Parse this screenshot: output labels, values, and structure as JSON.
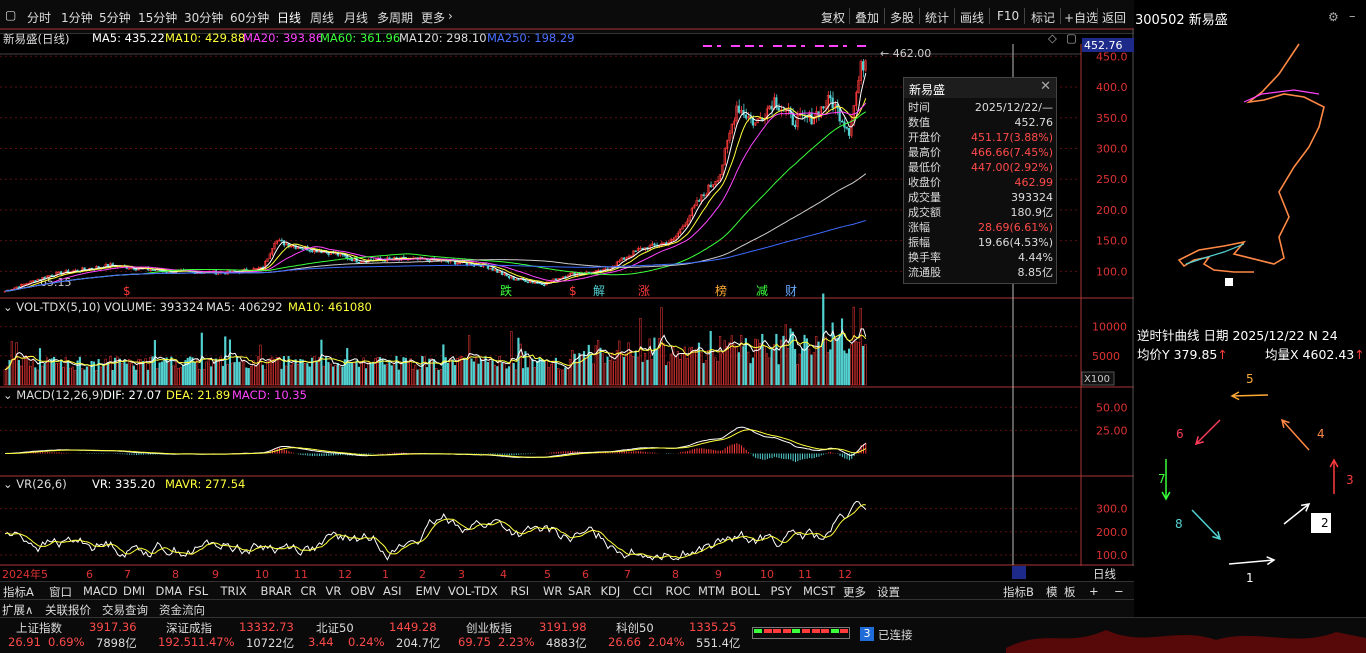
{
  "toolbar": {
    "periods": [
      "分时",
      "1分钟",
      "5分钟",
      "15分钟",
      "30分钟",
      "60分钟",
      "日线",
      "周线",
      "月线",
      "多周期",
      "更多"
    ],
    "active_period": "日线",
    "actions": [
      "复权",
      "叠加",
      "多股",
      "统计",
      "画线",
      "F10",
      "标记",
      "+自选",
      "返回"
    ]
  },
  "right_header": {
    "code_name": "300502 新易盛"
  },
  "price_header": {
    "stock": "新易盛(日线)",
    "ma5": "MA5: 435.22",
    "ma10": "MA10: 429.88",
    "ma20": "MA20: 393.86",
    "ma60": "MA60: 361.96",
    "ma120": "MA120: 298.10",
    "ma250": "MA250: 198.29"
  },
  "price_axis": {
    "ticks": [
      "450.0",
      "400.0",
      "350.0",
      "300.0",
      "250.0",
      "200.0",
      "150.0",
      "100.0"
    ],
    "current": "452.76",
    "high_label": "462.00",
    "low_label": "65.15"
  },
  "event_markers": [
    "$",
    "跌",
    "$",
    "解",
    "涨",
    "榜",
    "减",
    "财"
  ],
  "info_popup": {
    "title": "新易盛",
    "rows": [
      {
        "label": "时间",
        "value": "2025/12/22/—",
        "color": "#ddd"
      },
      {
        "label": "数值",
        "value": "452.76",
        "color": "#ddd"
      },
      {
        "label": "开盘价",
        "value": "451.17(3.88%)",
        "color": "#ff4a4a"
      },
      {
        "label": "最高价",
        "value": "466.66(7.45%)",
        "color": "#ff4a4a"
      },
      {
        "label": "最低价",
        "value": "447.00(2.92%)",
        "color": "#ff4a4a"
      },
      {
        "label": "收盘价",
        "value": "462.99",
        "color": "#ff4a4a"
      },
      {
        "label": "成交量",
        "value": "393324",
        "color": "#ddd"
      },
      {
        "label": "成交额",
        "value": "180.9亿",
        "color": "#ddd"
      },
      {
        "label": "涨幅",
        "value": "28.69(6.61%)",
        "color": "#ff4a4a"
      },
      {
        "label": "振幅",
        "value": "19.66(4.53%)",
        "color": "#ddd"
      },
      {
        "label": "换手率",
        "value": "4.44%",
        "color": "#ddd"
      },
      {
        "label": "流通股",
        "value": "8.85亿",
        "color": "#ddd"
      }
    ]
  },
  "vol_header": {
    "name": "VOL-TDX(5,10)",
    "volume": "VOLUME: 393324",
    "ma5": "MA5: 406292",
    "ma10": "MA10: 461080"
  },
  "vol_axis": {
    "ticks": [
      "10000",
      "5000"
    ],
    "unit": "X100"
  },
  "macd_header": {
    "name": "MACD(12,26,9)",
    "dif": "DIF: 27.07",
    "dea": "DEA: 21.89",
    "macd": "MACD: 10.35"
  },
  "macd_axis": {
    "ticks": [
      "50.00",
      "25.00"
    ]
  },
  "vr_header": {
    "name": "VR(26,6)",
    "vr": "VR: 335.20",
    "mavr": "MAVR: 277.54"
  },
  "vr_axis": {
    "ticks": [
      "300.0",
      "200.0",
      "100.0"
    ]
  },
  "date_axis": {
    "labels": [
      "2024年5",
      "6",
      "7",
      "8",
      "9",
      "10",
      "11",
      "12",
      "1",
      "2",
      "3",
      "4",
      "5",
      "6",
      "7",
      "8",
      "9",
      "10",
      "11",
      "12"
    ],
    "period": "日线"
  },
  "indicator_tabs": [
    "指标A",
    "窗口",
    "MACD",
    "DMI",
    "DMA",
    "FSL",
    "TRIX",
    "BRAR",
    "CR",
    "VR",
    "OBV",
    "ASI",
    "EMV",
    "VOL-TDX",
    "RSI",
    "WR",
    "SAR",
    "KDJ",
    "CCI",
    "ROC",
    "MTM",
    "BOLL",
    "PSY",
    "MCST",
    "更多",
    "设置"
  ],
  "indicator_right": [
    "指标B",
    "模",
    "板",
    "+",
    "−"
  ],
  "extra_tabs": [
    "扩展∧",
    "关联报价",
    "交易查询",
    "资金流向"
  ],
  "indices": [
    {
      "name": "上证指数",
      "value": "3917.36",
      "chg": "26.91",
      "pct": "0.69%",
      "amt": "7898亿"
    },
    {
      "name": "深证成指",
      "value": "13332.73",
      "chg": "192.51",
      "pct": "1.47%",
      "amt": "10722亿"
    },
    {
      "name": "北证50",
      "value": "1449.28",
      "chg": "3.44",
      "pct": "0.24%",
      "amt": "204.7亿"
    },
    {
      "name": "创业板指",
      "value": "3191.98",
      "chg": "69.75",
      "pct": "2.23%",
      "amt": "4883亿"
    },
    {
      "name": "科创50",
      "value": "1335.25",
      "chg": "26.66",
      "pct": "2.04%",
      "amt": "551.4亿"
    }
  ],
  "connection": {
    "badge": "3",
    "status": "已连接"
  },
  "ccw": {
    "title": "逆时针曲线 日期 2025/12/22 N 24",
    "avg_price": "均价Y 379.85",
    "avg_vol": "均量X 4602.43",
    "arrow_numbers": [
      "1",
      "2",
      "3",
      "4",
      "5",
      "6",
      "7",
      "8"
    ]
  },
  "colors": {
    "up": "#ff3b3b",
    "down": "#54d2d2",
    "ma5": "#ffffff",
    "ma10": "#ffff3b",
    "ma20": "#ff44ff",
    "ma60": "#3bff3b",
    "ma120": "#cccccc",
    "ma250": "#3f6bff"
  }
}
